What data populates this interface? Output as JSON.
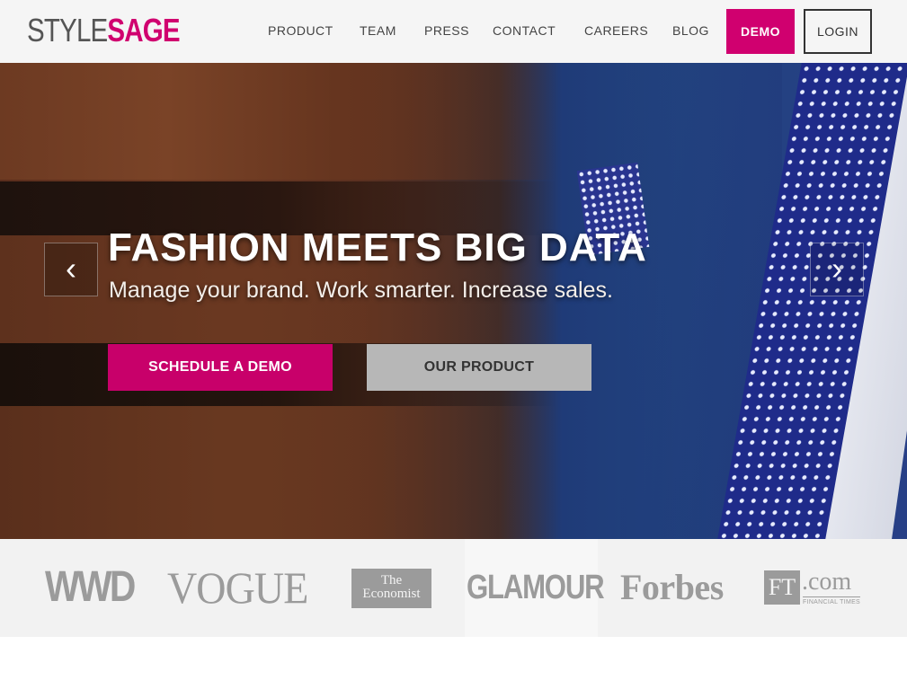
{
  "brand": {
    "part1": "STYLE",
    "part2": "SAGE",
    "accent_color": "#d0006f"
  },
  "nav": {
    "items": [
      "PRODUCT",
      "TEAM",
      "PRESS",
      "CONTACT",
      "CAREERS",
      "BLOG"
    ],
    "demo_label": "DEMO",
    "login_label": "LOGIN"
  },
  "hero": {
    "title": "FASHION MEETS BIG DATA",
    "subtitle": "Manage your brand. Work smarter. Increase sales.",
    "primary_cta": "SCHEDULE A DEMO",
    "secondary_cta": "OUR PRODUCT",
    "prev_icon": "chevron-left-icon",
    "next_icon": "chevron-right-icon"
  },
  "press": {
    "wwd": "WWD",
    "vogue": "VOGUE",
    "economist_line1": "The",
    "economist_line2": "Economist",
    "glamour": "GLAMOUR",
    "forbes": "Forbes",
    "ft_mark": "FT",
    "ft_domain": ".com",
    "ft_sub": "FINANCIAL TIMES"
  }
}
